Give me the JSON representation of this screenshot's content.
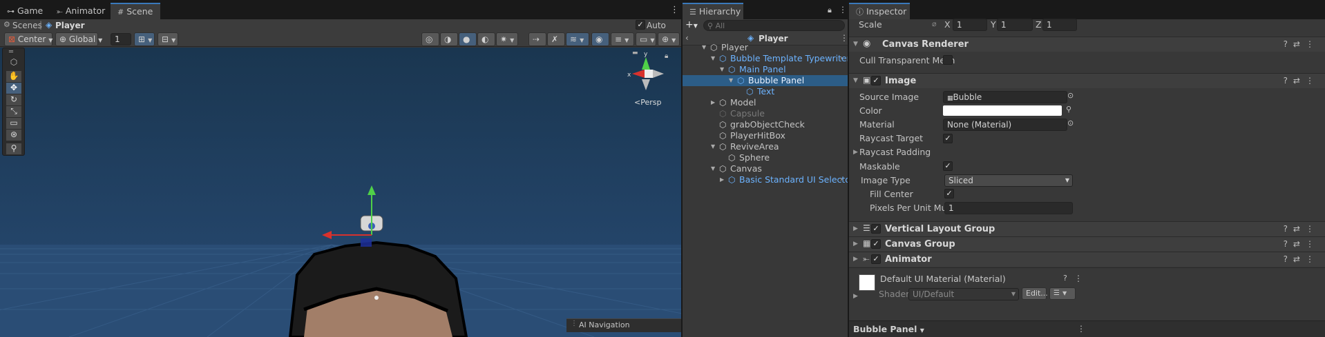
{
  "scene": {
    "tabs": [
      {
        "label": "Game",
        "icon": "gamepad-icon"
      },
      {
        "label": "Animator",
        "icon": "animator-icon"
      },
      {
        "label": "Scene",
        "icon": "grid-icon"
      }
    ],
    "breadcrumb": {
      "root": "Scenes",
      "current": "Player"
    },
    "auto_save_label": "Auto Save",
    "toolbar": {
      "pivot": "Center",
      "space": "Global",
      "grid_value": "1"
    },
    "gizmo": {
      "x": "x",
      "y": "y",
      "projection": "Persp"
    },
    "nav_overlay_label": "AI Navigation",
    "colors": {
      "sky": "#1f3a55",
      "floor": "#2a4a70",
      "x_axis": "#d9312c",
      "y_axis": "#4fd048"
    }
  },
  "hierarchy": {
    "tab_label": "Hierarchy",
    "search_placeholder": "All",
    "root_label": "Player",
    "items": [
      {
        "label": "Player",
        "depth": 0,
        "expanded": true,
        "style": "normal"
      },
      {
        "label": "Bubble Template Typewriter",
        "depth": 1,
        "expanded": true,
        "style": "prefab"
      },
      {
        "label": "Main Panel",
        "depth": 2,
        "expanded": true,
        "style": "prefab"
      },
      {
        "label": "Bubble Panel",
        "depth": 3,
        "expanded": true,
        "style": "selected"
      },
      {
        "label": "Text",
        "depth": 4,
        "expanded": false,
        "style": "prefab"
      },
      {
        "label": "Model",
        "depth": 1,
        "expanded": false,
        "style": "normal"
      },
      {
        "label": "Capsule",
        "depth": 1,
        "expanded": false,
        "style": "disabled"
      },
      {
        "label": "grabObjectCheck",
        "depth": 1,
        "expanded": false,
        "style": "normal"
      },
      {
        "label": "PlayerHitBox",
        "depth": 1,
        "expanded": false,
        "style": "normal"
      },
      {
        "label": "ReviveArea",
        "depth": 1,
        "expanded": true,
        "style": "normal"
      },
      {
        "label": "Sphere",
        "depth": 2,
        "expanded": false,
        "style": "normal"
      },
      {
        "label": "Canvas",
        "depth": 1,
        "expanded": true,
        "style": "normal"
      },
      {
        "label": "Basic Standard UI Selector Ele",
        "depth": 2,
        "expanded": false,
        "style": "prefab"
      }
    ]
  },
  "inspector": {
    "tab_label": "Inspector",
    "scale": {
      "label": "Scale",
      "x_label": "X",
      "x": "1",
      "y_label": "Y",
      "y": "1",
      "z_label": "Z",
      "z": "1"
    },
    "canvas_renderer": {
      "title": "Canvas Renderer",
      "cull_label": "Cull Transparent Mesh"
    },
    "image": {
      "title": "Image",
      "source_image_label": "Source Image",
      "source_image": "Bubble",
      "color_label": "Color",
      "color_value": "#ffffff",
      "material_label": "Material",
      "material": "None (Material)",
      "raycast_target_label": "Raycast Target",
      "raycast_padding_label": "Raycast Padding",
      "maskable_label": "Maskable",
      "image_type_label": "Image Type",
      "image_type": "Sliced",
      "fill_center_label": "Fill Center",
      "ppu_label": "Pixels Per Unit Multiplie",
      "ppu": "1"
    },
    "collapsed_components": [
      "Vertical Layout Group",
      "Canvas Group",
      "Animator"
    ],
    "material_asset": {
      "name": "Default UI Material (Material)",
      "shader_label": "Shader",
      "shader": "UI/Default",
      "edit_label": "Edit..."
    },
    "footer_label": "Bubble Panel"
  }
}
